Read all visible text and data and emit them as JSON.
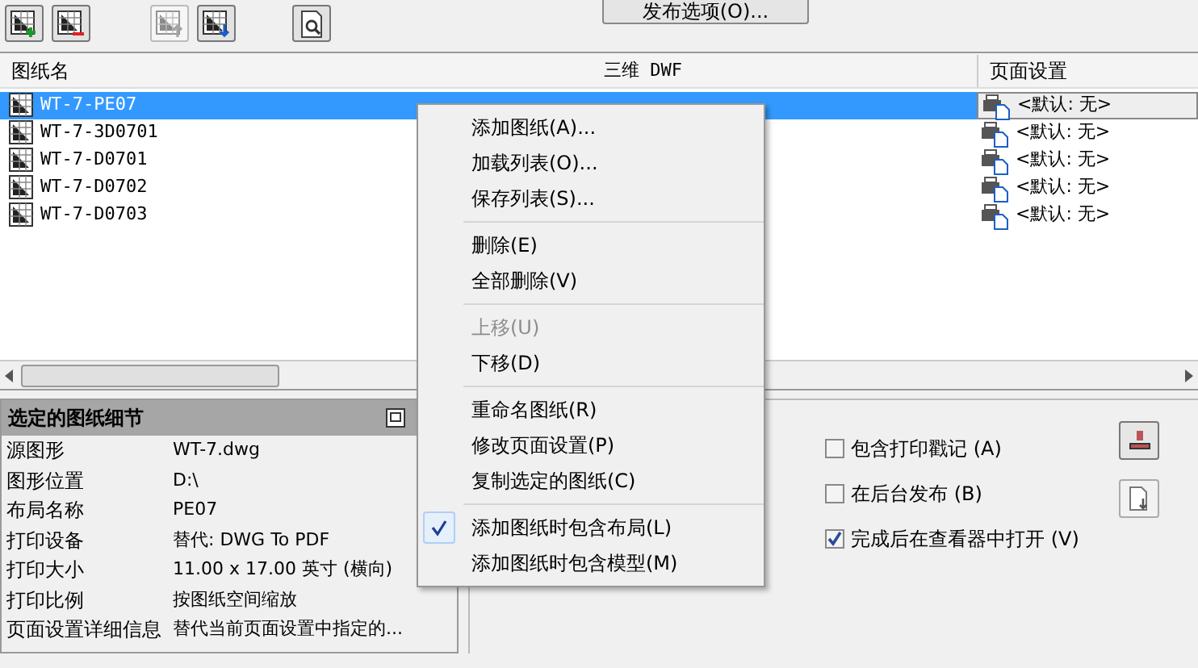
{
  "toolbar": {
    "buttons": [
      {
        "kind": "add",
        "disabled": false
      },
      {
        "kind": "remove",
        "disabled": false
      },
      {
        "kind": "up",
        "disabled": true
      },
      {
        "kind": "down",
        "disabled": false
      },
      {
        "kind": "preview",
        "disabled": false
      }
    ],
    "publish_options": "发布选项(O)..."
  },
  "sheet_list": {
    "columns": [
      "图纸名",
      "三维 DWF",
      "页面设置"
    ],
    "rows": [
      {
        "name": "WT-7-PE07",
        "page_setup": "<默认: 无>",
        "selected": true
      },
      {
        "name": "WT-7-3D0701",
        "page_setup": "<默认: 无>",
        "selected": false
      },
      {
        "name": "WT-7-D0701",
        "page_setup": "<默认: 无>",
        "selected": false
      },
      {
        "name": "WT-7-D0702",
        "page_setup": "<默认: 无>",
        "selected": false
      },
      {
        "name": "WT-7-D0703",
        "page_setup": "<默认: 无>",
        "selected": false
      }
    ]
  },
  "details": {
    "title": "选定的图纸细节",
    "rows": [
      {
        "label": "源图形",
        "value": "WT-7.dwg"
      },
      {
        "label": "图形位置",
        "value": "D:\\"
      },
      {
        "label": "布局名称",
        "value": "PE07"
      },
      {
        "label": "打印设备",
        "value": "替代: DWG To PDF"
      },
      {
        "label": "打印大小",
        "value": "11.00 x 17.00 英寸 (横向)"
      },
      {
        "label": "打印比例",
        "value": "按图纸空间缩放"
      },
      {
        "label": "页面设置详细信息",
        "value": "替代当前页面设置中指定的..."
      }
    ]
  },
  "options": [
    {
      "label": "包含打印戳记 (A)",
      "checked": false
    },
    {
      "label": "在后台发布 (B)",
      "checked": false
    },
    {
      "label": "完成后在查看器中打开 (V)",
      "checked": true
    }
  ],
  "context_menu": {
    "groups": [
      [
        {
          "label": "添加图纸(A)...",
          "disabled": false,
          "checked": false
        },
        {
          "label": "加载列表(O)...",
          "disabled": false,
          "checked": false
        },
        {
          "label": "保存列表(S)...",
          "disabled": false,
          "checked": false
        }
      ],
      [
        {
          "label": "删除(E)",
          "disabled": false,
          "checked": false
        },
        {
          "label": "全部删除(V)",
          "disabled": false,
          "checked": false
        }
      ],
      [
        {
          "label": "上移(U)",
          "disabled": true,
          "checked": false
        },
        {
          "label": "下移(D)",
          "disabled": false,
          "checked": false
        }
      ],
      [
        {
          "label": "重命名图纸(R)",
          "disabled": false,
          "checked": false
        },
        {
          "label": "修改页面设置(P)",
          "disabled": false,
          "checked": false
        },
        {
          "label": "复制选定的图纸(C)",
          "disabled": false,
          "checked": false
        }
      ],
      [
        {
          "label": "添加图纸时包含布局(L)",
          "disabled": false,
          "checked": true
        },
        {
          "label": "添加图纸时包含模型(M)",
          "disabled": false,
          "checked": false
        }
      ]
    ]
  }
}
